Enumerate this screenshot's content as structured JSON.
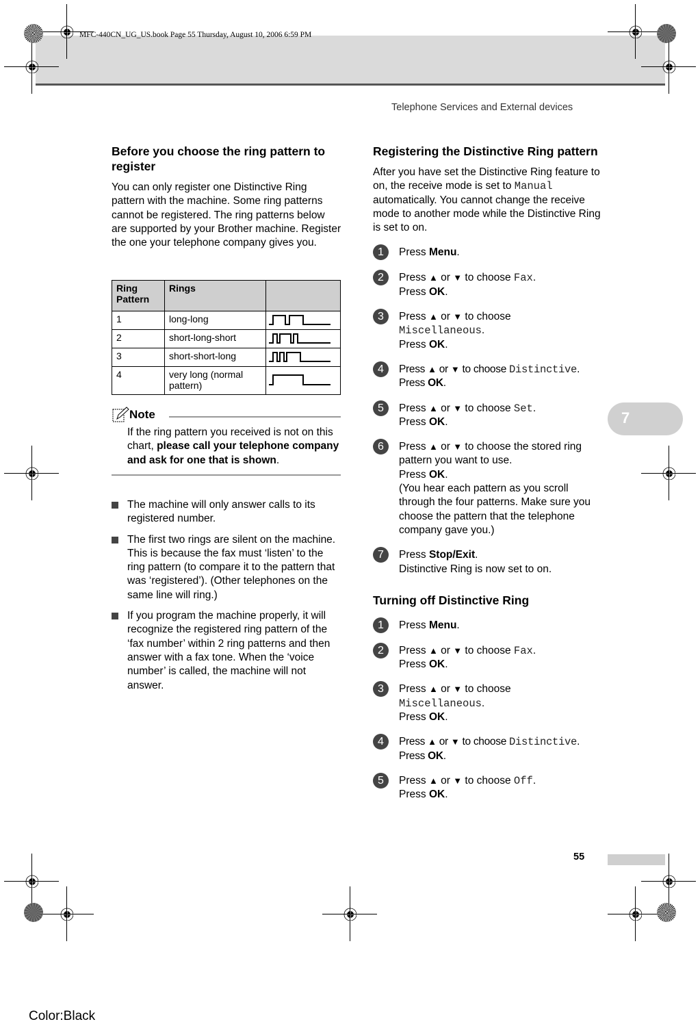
{
  "header": {
    "print_slug": "MFC-440CN_UG_US.book  Page 55  Thursday, August 10, 2006  6:59 PM",
    "running_head": "Telephone Services and External devices",
    "chapter_tab": "7"
  },
  "left": {
    "heading": "Before you choose the ring pattern to register",
    "intro": "You can only register one Distinctive Ring pattern with the machine. Some ring patterns cannot be registered. The ring patterns below are supported by your Brother machine. Register the one your telephone company gives you.",
    "table": {
      "headers": [
        "Ring Pattern",
        "Rings",
        ""
      ],
      "rows": [
        {
          "pattern": "1",
          "rings": "long-long",
          "waveform": "long-long"
        },
        {
          "pattern": "2",
          "rings": "short-long-short",
          "waveform": "short-long-short"
        },
        {
          "pattern": "3",
          "rings": "short-short-long",
          "waveform": "short-short-long"
        },
        {
          "pattern": "4",
          "rings": "very long (normal pattern)",
          "waveform": "very-long"
        }
      ]
    },
    "note": {
      "title": "Note",
      "text_plain": "If the ring pattern you received is not on this chart, ",
      "text_bold": "please call your telephone company and ask for one that is shown",
      "text_end": "."
    },
    "bullets": [
      "The machine will only answer calls to its registered number.",
      "The first two rings are silent on the machine. This is because the fax must ‘listen’ to the ring pattern (to compare it to the pattern that was ‘registered’). (Other telephones on the same line will ring.)",
      "If you program the machine properly, it will recognize the registered ring pattern of the ‘fax number’ within 2 ring patterns and then answer with a fax tone. When the ‘voice number’ is called, the machine will not answer."
    ]
  },
  "right": {
    "heading1": "Registering the Distinctive Ring pattern",
    "intro_a": "After you have set the Distinctive Ring feature to on, the receive mode is set to ",
    "intro_mono": "Manual",
    "intro_b": " automatically. You cannot change the receive mode to another mode while the Distinctive Ring is set to on.",
    "press": "Press ",
    "or": " or ",
    "to_choose": " to choose ",
    "menu": "Menu",
    "ok": "OK",
    "up": "▲",
    "down": "▼",
    "period": ".",
    "fax": "Fax",
    "misc": "Miscellaneous",
    "distinctive": "Distinctive",
    "set": "Set",
    "off": "Off",
    "step6_text": " to choose the stored ring pattern you want to use.",
    "step6_note": "(You hear each pattern as you scroll through the four patterns. Make sure you choose the pattern that the telephone company gave you.)",
    "stop_exit": "Stop/Exit",
    "step7_note": "Distinctive Ring is now set to on.",
    "heading2": "Turning off Distinctive Ring",
    "nums": [
      "1",
      "2",
      "3",
      "4",
      "5",
      "6",
      "7"
    ]
  },
  "footer": {
    "page_number": "55",
    "color_label": "Color:Black"
  }
}
